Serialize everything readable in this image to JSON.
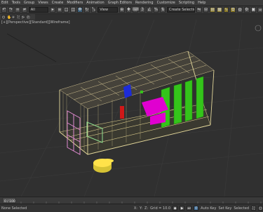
{
  "menubar": {
    "items": [
      "Edit",
      "Tools",
      "Group",
      "Views",
      "Create",
      "Modifiers",
      "Animation",
      "Graph Editors",
      "Rendering",
      "Customize",
      "Scripting",
      "Help"
    ]
  },
  "toolbar": {
    "select_value": "All",
    "view_value": "View",
    "named_set_value": "Create Selection Se"
  },
  "viewport": {
    "label": "[+][Perspective][Standard][Wireframe]",
    "colors": {
      "room": "#d8c98a",
      "door": "#e08ad0",
      "window": "#8fe08f",
      "magenta": "#e000d0",
      "green": "#34c41a",
      "red": "#d01818",
      "blue": "#1d2cd8",
      "yellow": "#ffe24a"
    }
  },
  "timeline": {
    "frame": "0 / 100"
  },
  "statusbar": {
    "selection": "None Selected",
    "x_label": "X:",
    "y_label": "Y:",
    "z_label": "Z:",
    "grid": "Grid = 10.0",
    "auto_key": "Auto Key",
    "set_key": "Set Key",
    "selected": "Selected"
  }
}
